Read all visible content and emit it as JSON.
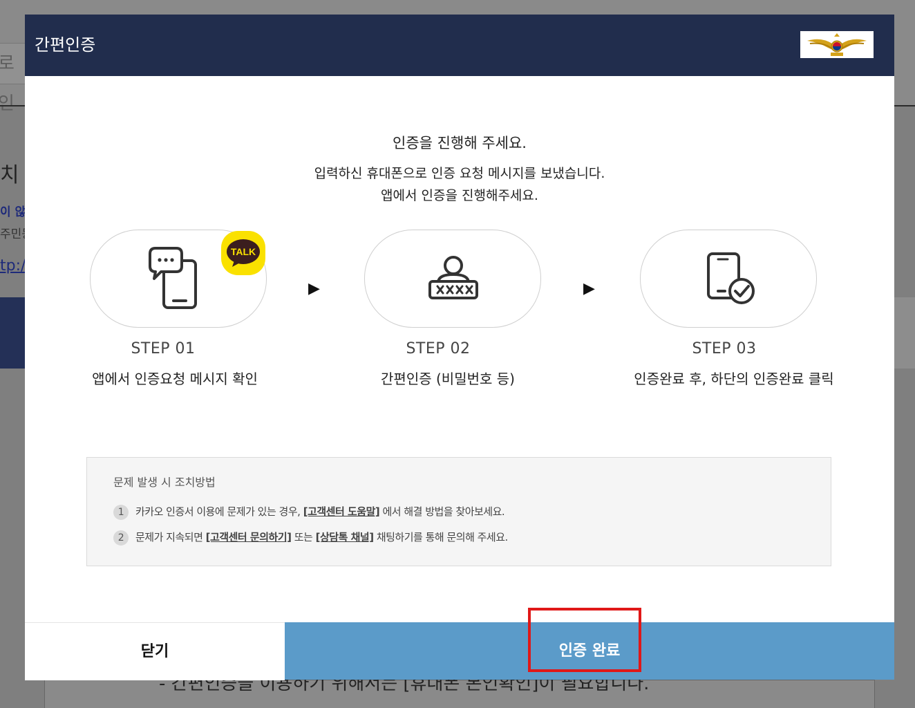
{
  "background": {
    "input_fragment": "로 인",
    "frag1": "치",
    "frag2": "이 않",
    "frag3": "주민등",
    "frag4": "tp:/",
    "bottom_text": "- 간편인증을 이용하기 위해서는 [휴대폰 본인확인]이 필요합니다."
  },
  "modal": {
    "title": "간편인증",
    "emblem_icon": "police-emblem-icon",
    "intro_title": "인증을 진행해 주세요.",
    "intro_line1": "입력하신 휴대폰으로 인증 요청 메시지를 보냈습니다.",
    "intro_line2": "앱에서 인증을 진행해주세요.",
    "arrow": "▶",
    "steps": [
      {
        "label": "STEP 01",
        "desc": "앱에서 인증요청 메시지 확인",
        "icon": "phone-chat-icon",
        "badge": "TALK"
      },
      {
        "label": "STEP 02",
        "desc": "간편인증 (비밀번호 등)",
        "icon": "user-password-icon"
      },
      {
        "label": "STEP 03",
        "desc": "인증완료 후, 하단의 인증완료 클릭",
        "icon": "phone-check-icon"
      }
    ],
    "help": {
      "title": "문제 발생 시 조치방법",
      "row1_num": "1",
      "row1_pre": "카카오 인증서 이용에 문제가 있는 경우, ",
      "row1_link": "[고객센터 도움말]",
      "row1_post": " 에서 해결 방법을 찾아보세요.",
      "row2_num": "2",
      "row2_pre": "문제가 지속되면 ",
      "row2_link1": "[고객센터 문의하기]",
      "row2_mid": " 또는 ",
      "row2_link2": "[상담톡 채널]",
      "row2_post": " 채팅하기를 통해 문의해 주세요."
    },
    "close_label": "닫기",
    "confirm_label": "인증 완료"
  },
  "colors": {
    "header_bg": "#212d4d",
    "confirm_bg": "#5b9bc9",
    "highlight": "#e01818",
    "kakao_yellow": "#fae100"
  }
}
